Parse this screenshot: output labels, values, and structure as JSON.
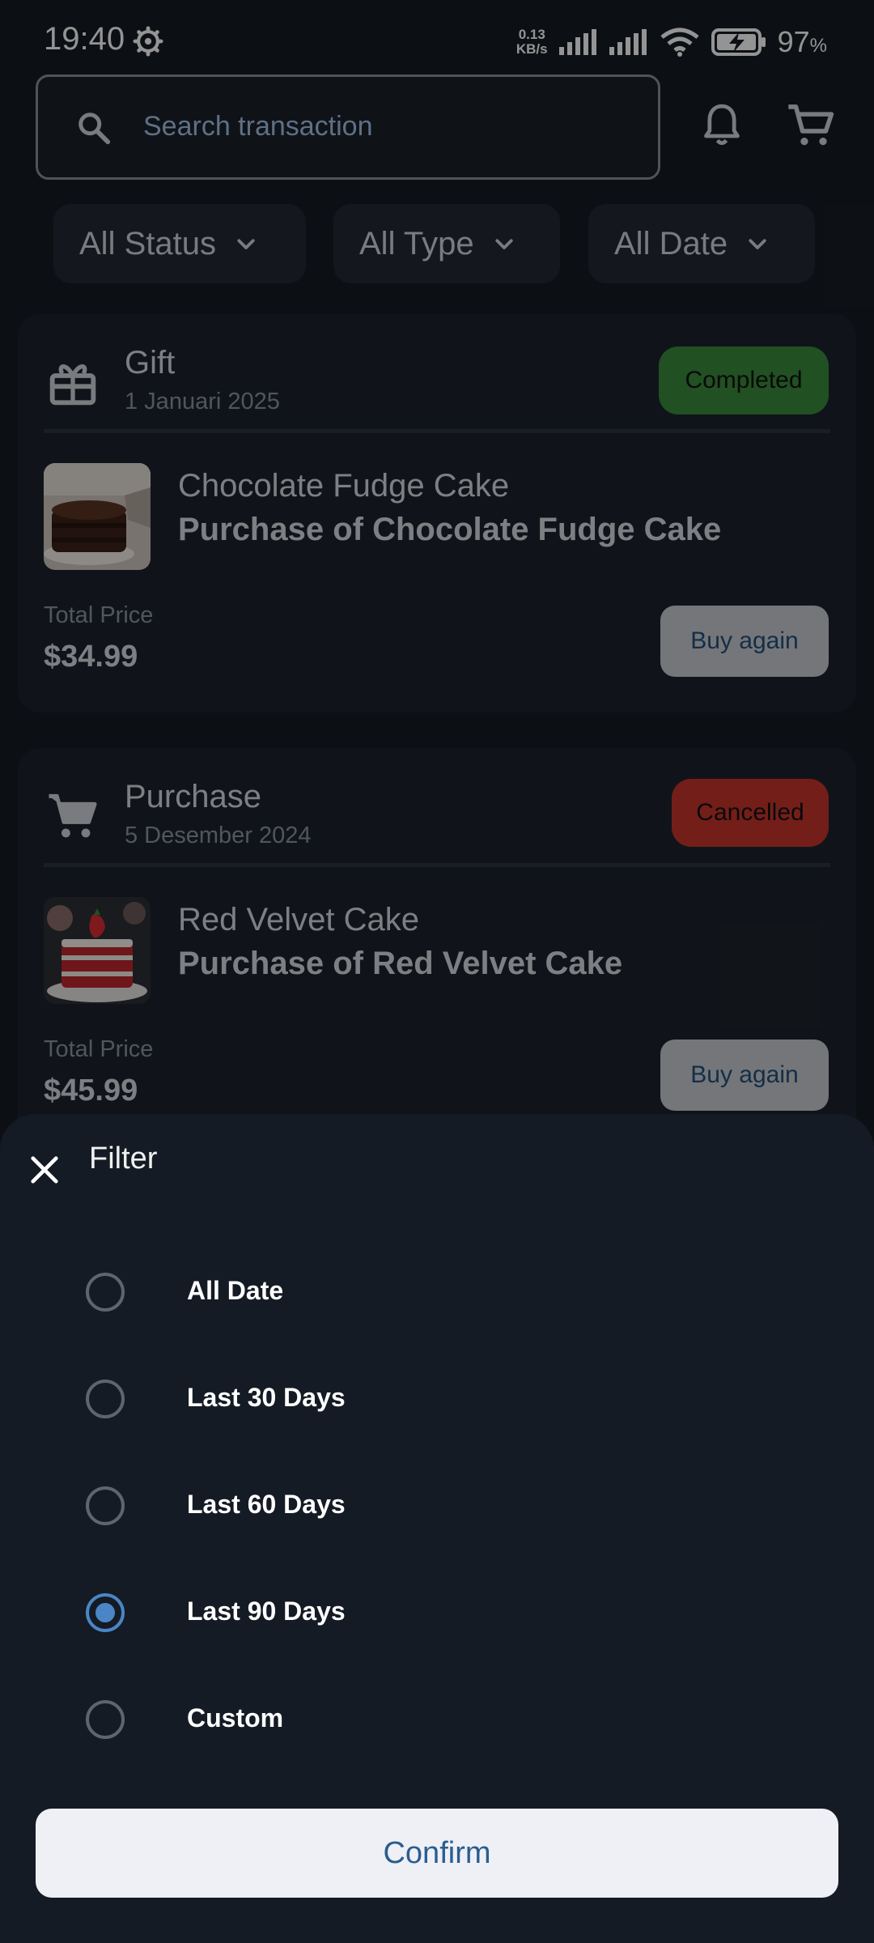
{
  "status_bar": {
    "time": "19:40",
    "net_speed_value": "0.13",
    "net_speed_unit": "KB/s",
    "battery_percent": "97",
    "battery_unit": "%"
  },
  "search": {
    "placeholder": "Search transaction"
  },
  "icons": {
    "search": "search-icon",
    "notifications": "bell-icon",
    "cart": "cart-icon",
    "gift": "gift-icon",
    "purchase": "cart-icon",
    "close": "close-icon",
    "dropdown": "chevron-down-icon"
  },
  "filters": [
    {
      "label": "All Status"
    },
    {
      "label": "All Type"
    },
    {
      "label": "All Date"
    }
  ],
  "transactions": [
    {
      "type": "Gift",
      "date": "1 Januari 2025",
      "status": "Completed",
      "status_color": "#3a8a3c",
      "product_name": "Chocolate Fudge Cake",
      "description": "Purchase of Chocolate Fudge Cake",
      "price_label": "Total Price",
      "price": "$34.99",
      "action": "Buy again"
    },
    {
      "type": "Purchase",
      "date": "5 Desember 2024",
      "status": "Cancelled",
      "status_color": "#c9352b",
      "product_name": "Red Velvet Cake",
      "description": "Purchase of Red Velvet Cake",
      "price_label": "Total Price",
      "price": "$45.99",
      "action": "Buy again"
    }
  ],
  "sheet": {
    "title": "Filter",
    "options": [
      {
        "label": "All Date",
        "selected": false
      },
      {
        "label": "Last 30 Days",
        "selected": false
      },
      {
        "label": "Last 60 Days",
        "selected": false
      },
      {
        "label": "Last 90 Days",
        "selected": true
      },
      {
        "label": "Custom",
        "selected": false
      }
    ],
    "confirm_label": "Confirm"
  },
  "colors": {
    "accent": "#4a86c5",
    "confirm_text": "#2b5d8f",
    "completed": "#3a8a3c",
    "cancelled": "#c9352b"
  }
}
